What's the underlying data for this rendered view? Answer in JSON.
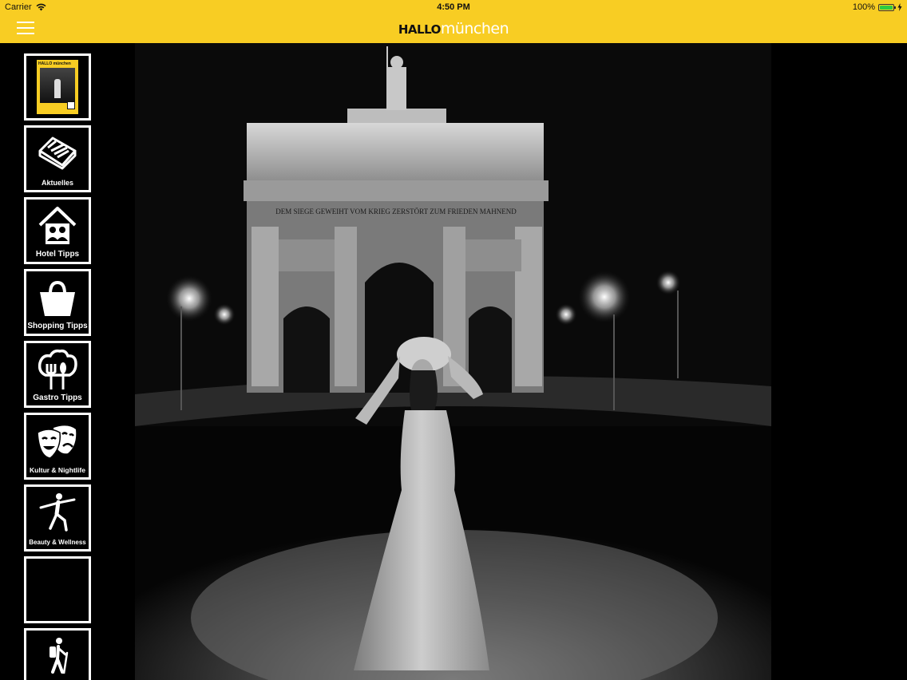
{
  "status_bar": {
    "carrier": "Carrier",
    "time": "4:50 PM",
    "battery": "100%",
    "battery_level": 1.0,
    "battery_color": "#2ecc40"
  },
  "nav_bar": {
    "background_color": "#f8cd23",
    "menu_icon": "hamburger-icon",
    "logo_part1": "HALLO",
    "logo_part2": "münchen"
  },
  "sidebar": {
    "items": [
      {
        "label": "",
        "icon": "magazine-cover-icon"
      },
      {
        "label": "Aktuelles",
        "icon": "newspaper-icon"
      },
      {
        "label": "Hotel Tipps",
        "icon": "hotel-house-icon"
      },
      {
        "label": "Shopping Tipps",
        "icon": "shopping-bag-icon"
      },
      {
        "label": "Gastro Tipps",
        "icon": "chef-hat-cutlery-icon"
      },
      {
        "label": "Kultur & Nightlife",
        "icon": "theater-masks-icon"
      },
      {
        "label": "Beauty & Wellness",
        "icon": "yoga-figure-icon"
      },
      {
        "label": "",
        "icon": ""
      },
      {
        "label": "",
        "icon": "hiker-icon"
      }
    ]
  },
  "main_image": {
    "inscription": "DEM SIEGE GEWEIHT VOM KRIEG ZERSTÖRT ZUM FRIEDEN MAHNEND"
  }
}
